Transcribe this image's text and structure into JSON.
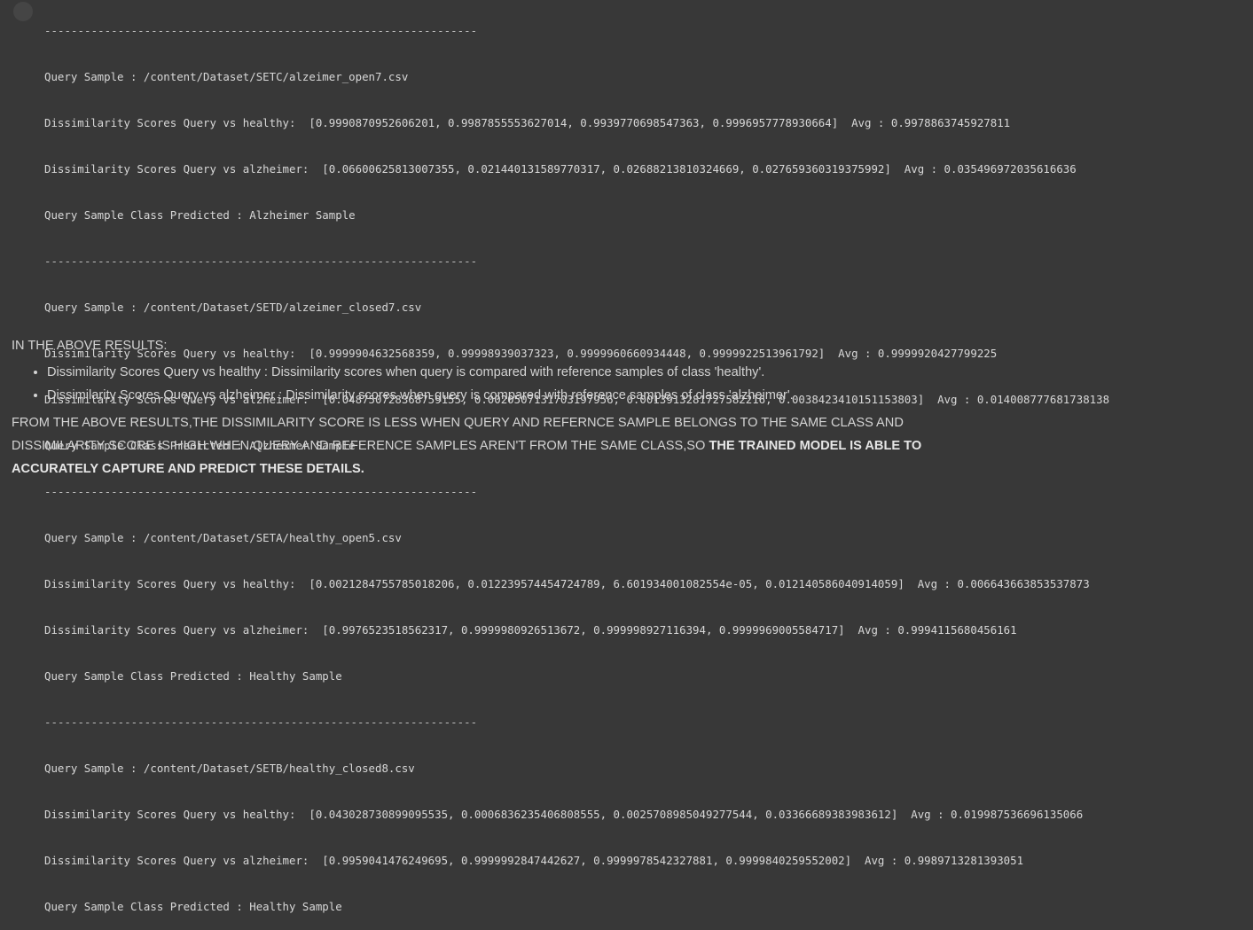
{
  "output_lines": [
    {
      "type": "separator",
      "text": "-----------------------------------------------------------------"
    },
    {
      "type": "text",
      "text": "Query Sample : /content/Dataset/SETC/alzeimer_open7.csv"
    },
    {
      "type": "text",
      "text": "Dissimilarity Scores Query vs healthy:  [0.9990870952606201, 0.9987855553627014, 0.9939770698547363, 0.9996957778930664]  Avg : 0.9978863745927811"
    },
    {
      "type": "text",
      "text": "Dissimilarity Scores Query vs alzheimer:  [0.06600625813007355, 0.021440131589770317, 0.02688213810324669, 0.027659360319375992]  Avg : 0.035496972035616636"
    },
    {
      "type": "text",
      "text": "Query Sample Class Predicted : Alzheimer Sample"
    },
    {
      "type": "separator",
      "text": "-----------------------------------------------------------------"
    },
    {
      "type": "text",
      "text": "Query Sample : /content/Dataset/SETD/alzeimer_closed7.csv"
    },
    {
      "type": "text",
      "text": "Dissimilarity Scores Query vs healthy:  [0.9999904632568359, 0.99998939037323, 0.9999960660934448, 0.9999922513961792]  Avg : 0.9999920427799225"
    },
    {
      "type": "text",
      "text": "Dissimilarity Scores Query vs alzheimer:  [0.048750728368759155, 0.0020507131703197956, 0.0013913281727582216, 0.0038423410151153803]  Avg : 0.014008777681738138"
    },
    {
      "type": "text",
      "text": "Query Sample Class Predicted : Alzheimer Sample"
    },
    {
      "type": "separator",
      "text": "-----------------------------------------------------------------"
    },
    {
      "type": "text",
      "text": "Query Sample : /content/Dataset/SETA/healthy_open5.csv"
    },
    {
      "type": "text",
      "text": "Dissimilarity Scores Query vs healthy:  [0.0021284755785018206, 0.012239574454724789, 6.601934001082554e-05, 0.012140586040914059]  Avg : 0.006643663853537873"
    },
    {
      "type": "text",
      "text": "Dissimilarity Scores Query vs alzheimer:  [0.9976523518562317, 0.9999980926513672, 0.999998927116394, 0.9999969005584717]  Avg : 0.9994115680456161"
    },
    {
      "type": "text",
      "text": "Query Sample Class Predicted : Healthy Sample"
    },
    {
      "type": "separator",
      "text": "-----------------------------------------------------------------"
    },
    {
      "type": "text",
      "text": "Query Sample : /content/Dataset/SETB/healthy_closed8.csv"
    },
    {
      "type": "text",
      "text": "Dissimilarity Scores Query vs healthy:  [0.043028730899095535, 0.0006836235406808555, 0.0025708985049277544, 0.03366689383983612]  Avg : 0.019987536696135066"
    },
    {
      "type": "text",
      "text": "Dissimilarity Scores Query vs alzheimer:  [0.9959041476249695, 0.9999992847442627, 0.9999978542327881, 0.9999840259552002]  Avg : 0.9989713281393051"
    },
    {
      "type": "text",
      "text": "Query Sample Class Predicted : Healthy Sample"
    }
  ],
  "markdown": {
    "heading": "IN THE ABOVE RESULTS:",
    "bullets": [
      "Dissimilarity Scores Query vs healthy : Dissimilarity scores when query is compared with reference samples of class 'healthy'.",
      "Dissimilarity Scores Query vs alzheimer : Dissimilarity scores when query is compared with reference samples of class 'alzheimer'."
    ],
    "conclusion_plain": "FROM THE ABOVE RESULTS,THE DISSIMILARITY SCORE IS LESS WHEN QUERY AND REFERNCE SAMPLE BELONGS TO THE SAME CLASS AND DISSIMILARITY SCORE IS HIGH WHEN QUERY AND REFERENCE SAMPLES AREN'T FROM THE SAME CLASS,SO ",
    "conclusion_bold": "THE TRAINED MODEL IS ABLE TO ACCURATELY CAPTURE AND PREDICT THESE DETAILS."
  }
}
